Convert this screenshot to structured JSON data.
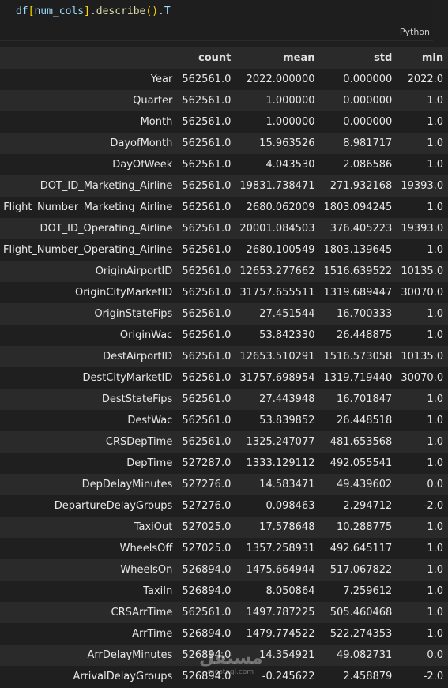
{
  "cell": {
    "code_tokens": [
      {
        "text": "df",
        "cls": "tok-var"
      },
      {
        "text": "[",
        "cls": "tok-br"
      },
      {
        "text": "num_cols",
        "cls": "tok-var"
      },
      {
        "text": "]",
        "cls": "tok-br"
      },
      {
        "text": ".",
        "cls": "tok-pun"
      },
      {
        "text": "describe",
        "cls": "tok-fn"
      },
      {
        "text": "()",
        "cls": "tok-br"
      },
      {
        "text": ".",
        "cls": "tok-pun"
      },
      {
        "text": "T",
        "cls": "tok-var"
      }
    ],
    "language": "Python"
  },
  "table": {
    "columns": [
      "count",
      "mean",
      "std",
      "min"
    ],
    "rows": [
      {
        "label": "Year",
        "values": [
          "562561.0",
          "2022.000000",
          "0.000000",
          "2022.0"
        ]
      },
      {
        "label": "Quarter",
        "values": [
          "562561.0",
          "1.000000",
          "0.000000",
          "1.0"
        ]
      },
      {
        "label": "Month",
        "values": [
          "562561.0",
          "1.000000",
          "0.000000",
          "1.0"
        ]
      },
      {
        "label": "DayofMonth",
        "values": [
          "562561.0",
          "15.963526",
          "8.981717",
          "1.0"
        ]
      },
      {
        "label": "DayOfWeek",
        "values": [
          "562561.0",
          "4.043530",
          "2.086586",
          "1.0"
        ]
      },
      {
        "label": "DOT_ID_Marketing_Airline",
        "values": [
          "562561.0",
          "19831.738471",
          "271.932168",
          "19393.0"
        ]
      },
      {
        "label": "Flight_Number_Marketing_Airline",
        "values": [
          "562561.0",
          "2680.062009",
          "1803.094245",
          "1.0"
        ]
      },
      {
        "label": "DOT_ID_Operating_Airline",
        "values": [
          "562561.0",
          "20001.084503",
          "376.405223",
          "19393.0"
        ]
      },
      {
        "label": "Flight_Number_Operating_Airline",
        "values": [
          "562561.0",
          "2680.100549",
          "1803.139645",
          "1.0"
        ]
      },
      {
        "label": "OriginAirportID",
        "values": [
          "562561.0",
          "12653.277662",
          "1516.639522",
          "10135.0"
        ]
      },
      {
        "label": "OriginCityMarketID",
        "values": [
          "562561.0",
          "31757.655511",
          "1319.689447",
          "30070.0"
        ]
      },
      {
        "label": "OriginStateFips",
        "values": [
          "562561.0",
          "27.451544",
          "16.700333",
          "1.0"
        ]
      },
      {
        "label": "OriginWac",
        "values": [
          "562561.0",
          "53.842330",
          "26.448875",
          "1.0"
        ]
      },
      {
        "label": "DestAirportID",
        "values": [
          "562561.0",
          "12653.510291",
          "1516.573058",
          "10135.0"
        ]
      },
      {
        "label": "DestCityMarketID",
        "values": [
          "562561.0",
          "31757.698954",
          "1319.719440",
          "30070.0"
        ]
      },
      {
        "label": "DestStateFips",
        "values": [
          "562561.0",
          "27.443948",
          "16.701847",
          "1.0"
        ]
      },
      {
        "label": "DestWac",
        "values": [
          "562561.0",
          "53.839852",
          "26.448518",
          "1.0"
        ]
      },
      {
        "label": "CRSDepTime",
        "values": [
          "562561.0",
          "1325.247077",
          "481.653568",
          "1.0"
        ]
      },
      {
        "label": "DepTime",
        "values": [
          "527287.0",
          "1333.129112",
          "492.055541",
          "1.0"
        ]
      },
      {
        "label": "DepDelayMinutes",
        "values": [
          "527276.0",
          "14.583471",
          "49.439602",
          "0.0"
        ]
      },
      {
        "label": "DepartureDelayGroups",
        "values": [
          "527276.0",
          "0.098463",
          "2.294712",
          "-2.0"
        ]
      },
      {
        "label": "TaxiOut",
        "values": [
          "527025.0",
          "17.578648",
          "10.288775",
          "1.0"
        ]
      },
      {
        "label": "WheelsOff",
        "values": [
          "527025.0",
          "1357.258931",
          "492.645117",
          "1.0"
        ]
      },
      {
        "label": "WheelsOn",
        "values": [
          "526894.0",
          "1475.664944",
          "517.067822",
          "1.0"
        ]
      },
      {
        "label": "TaxiIn",
        "values": [
          "526894.0",
          "8.050864",
          "7.259612",
          "1.0"
        ]
      },
      {
        "label": "CRSArrTime",
        "values": [
          "562561.0",
          "1497.787225",
          "505.460468",
          "1.0"
        ]
      },
      {
        "label": "ArrTime",
        "values": [
          "526894.0",
          "1479.774522",
          "522.274353",
          "1.0"
        ]
      },
      {
        "label": "ArrDelayMinutes",
        "values": [
          "526894.0",
          "14.354921",
          "49.082731",
          "0.0"
        ]
      },
      {
        "label": "ArrivalDelayGroups",
        "values": [
          "526894.0",
          "-0.245622",
          "2.458879",
          "-2.0"
        ]
      }
    ]
  },
  "watermark": {
    "main": "مستقل",
    "sub": "mostaql.com"
  }
}
